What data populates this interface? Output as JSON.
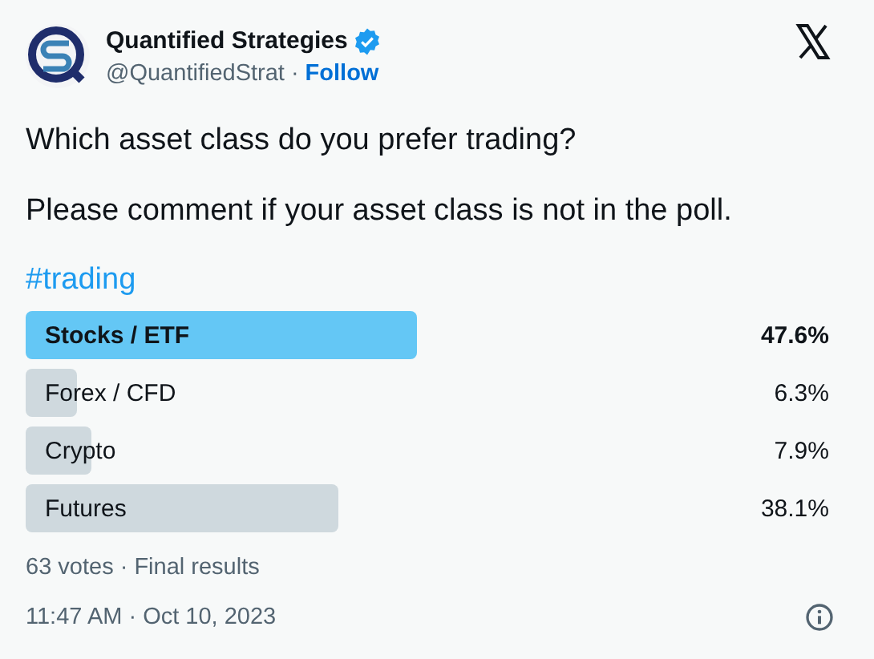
{
  "author": {
    "name": "Quantified Strategies",
    "verified": true,
    "handle": "@QuantifiedStrat",
    "separator": "·",
    "follow": "Follow"
  },
  "text": [
    "Which asset class do you prefer trading?",
    "Please comment if your asset class is not in the poll."
  ],
  "hashtag": "#trading",
  "poll": {
    "options": [
      {
        "label": "Stocks / ETF",
        "percent": "47.6%",
        "selected": true
      },
      {
        "label": "Forex / CFD",
        "percent": "6.3%",
        "selected": false
      },
      {
        "label": "Crypto",
        "percent": "7.9%",
        "selected": false
      },
      {
        "label": "Futures",
        "percent": "38.1%",
        "selected": false
      }
    ],
    "summary": "63 votes · Final results"
  },
  "timestamp": "11:47 AM · Oct 10, 2023"
}
